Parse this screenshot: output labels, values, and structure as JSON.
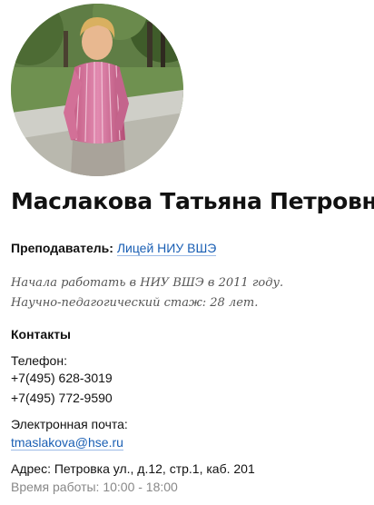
{
  "profile": {
    "name": "Маслакова Татьяна Петровна",
    "photo_alt": "photo"
  },
  "position": {
    "label": "Преподаватель:",
    "org_link": "Лицей НИУ ВШЭ"
  },
  "bio": {
    "line1": "Начала работать в НИУ ВШЭ в 2011 году.",
    "line2": "Научно-педагогический стаж: 28 лет."
  },
  "contacts": {
    "title": "Контакты",
    "phone_label": "Телефон:",
    "phones": [
      "+7(495) 628-3019",
      "+7(495) 772-9590"
    ],
    "email_label": "Электронная почта:",
    "email": "tmaslakova@hse.ru",
    "address": "Адрес: Петровка ул., д.12, стр.1, каб. 201",
    "hours": "Время работы: 10:00 - 18:00"
  }
}
